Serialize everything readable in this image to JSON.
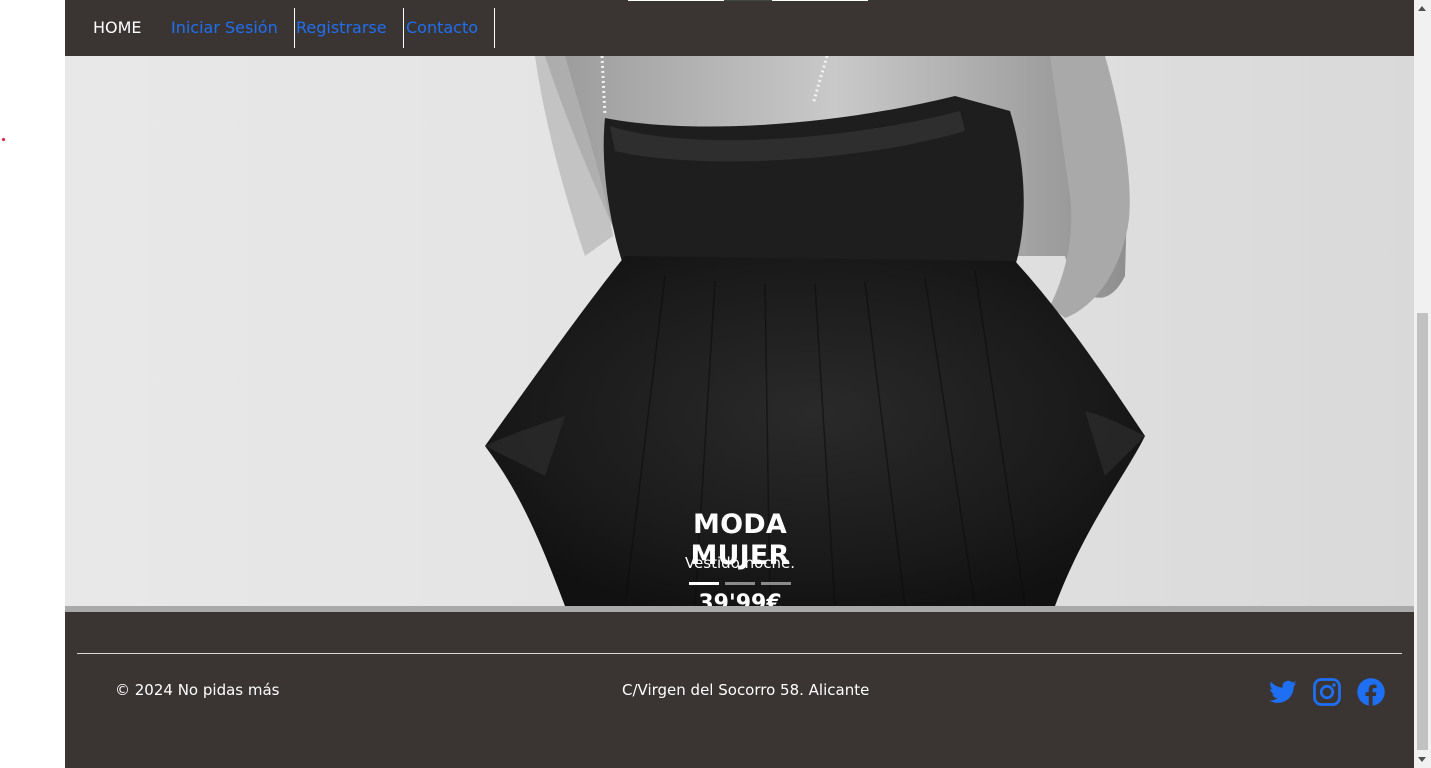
{
  "nav": {
    "home": "HOME",
    "login": "Iniciar Sesión",
    "register": "Registrarse",
    "contact": "Contacto"
  },
  "carousel": {
    "title": "MODA MUJER",
    "description": "Vestido noche.",
    "price": "39'99€",
    "slide_count": 3,
    "active_slide": 1
  },
  "footer": {
    "copyright": "© 2024 No pidas más",
    "address": "C/Virgen del Socorro 58. Alicante",
    "socials": [
      "twitter-icon",
      "instagram-icon",
      "facebook-icon"
    ]
  },
  "colors": {
    "background": "#3a3533",
    "link": "#1f6ff2",
    "text": "#ffffff"
  }
}
